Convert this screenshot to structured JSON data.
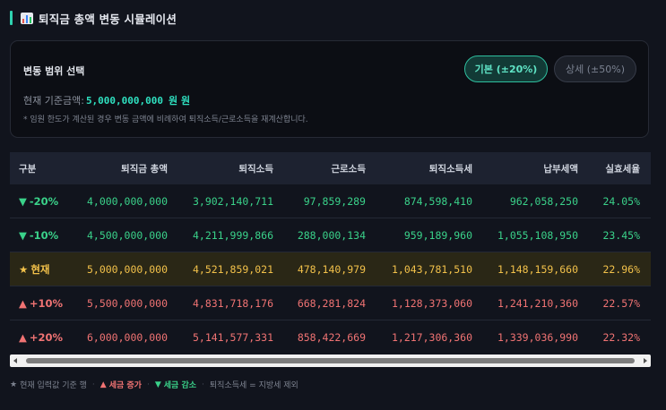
{
  "header": {
    "title": "퇴직금 총액 변동 시뮬레이션",
    "icon": "bar-chart-icon"
  },
  "controls": {
    "label": "변동 범위 선택",
    "basic_button": "기본 (±20%)",
    "detail_button": "상세 (±50%)",
    "current_label": "현재 기준금액:",
    "current_value": "5,000,000,000",
    "current_unit": "원 원",
    "note": "* 임원 한도가 계산된 경우 변동 금액에 비례하여 퇴직소득/근로소득을 재계산합니다."
  },
  "table": {
    "columns": [
      "구분",
      "퇴직금 총액",
      "퇴직소득",
      "근로소득",
      "퇴직소득세",
      "납부세액",
      "실효세율"
    ],
    "rows": [
      {
        "type": "down",
        "icon": "▼",
        "label": "-20%",
        "total": "4,000,000,000",
        "retirement": "3,902,140,711",
        "earned": "97,859,289",
        "retirement_tax": "874,598,410",
        "payable": "962,058,250",
        "rate": "24.05%"
      },
      {
        "type": "down",
        "icon": "▼",
        "label": "-10%",
        "total": "4,500,000,000",
        "retirement": "4,211,999,866",
        "earned": "288,000,134",
        "retirement_tax": "959,189,960",
        "payable": "1,055,108,950",
        "rate": "23.45%"
      },
      {
        "type": "current",
        "icon": "★",
        "label": "현재",
        "total": "5,000,000,000",
        "retirement": "4,521,859,021",
        "earned": "478,140,979",
        "retirement_tax": "1,043,781,510",
        "payable": "1,148,159,660",
        "rate": "22.96%"
      },
      {
        "type": "up",
        "icon": "▲",
        "label": "+10%",
        "total": "5,500,000,000",
        "retirement": "4,831,718,176",
        "earned": "668,281,824",
        "retirement_tax": "1,128,373,060",
        "payable": "1,241,210,360",
        "rate": "22.57%"
      },
      {
        "type": "up",
        "icon": "▲",
        "label": "+20%",
        "total": "6,000,000,000",
        "retirement": "5,141,577,331",
        "earned": "858,422,669",
        "retirement_tax": "1,217,306,360",
        "payable": "1,339,036,990",
        "rate": "22.32%"
      }
    ]
  },
  "legend": {
    "current_icon": "★",
    "current_text": "현재 입력값 기준 행",
    "sep": "·",
    "up_icon": "▲",
    "up_text": "세금 증가",
    "down_icon": "▼",
    "down_text": "세금 감소",
    "footnote": "퇴직소득세 = 지방세 제외"
  },
  "colors": {
    "accent": "#2fd2b0",
    "up": "#f07373",
    "down": "#3ad28a",
    "current": "#f2c14a"
  }
}
